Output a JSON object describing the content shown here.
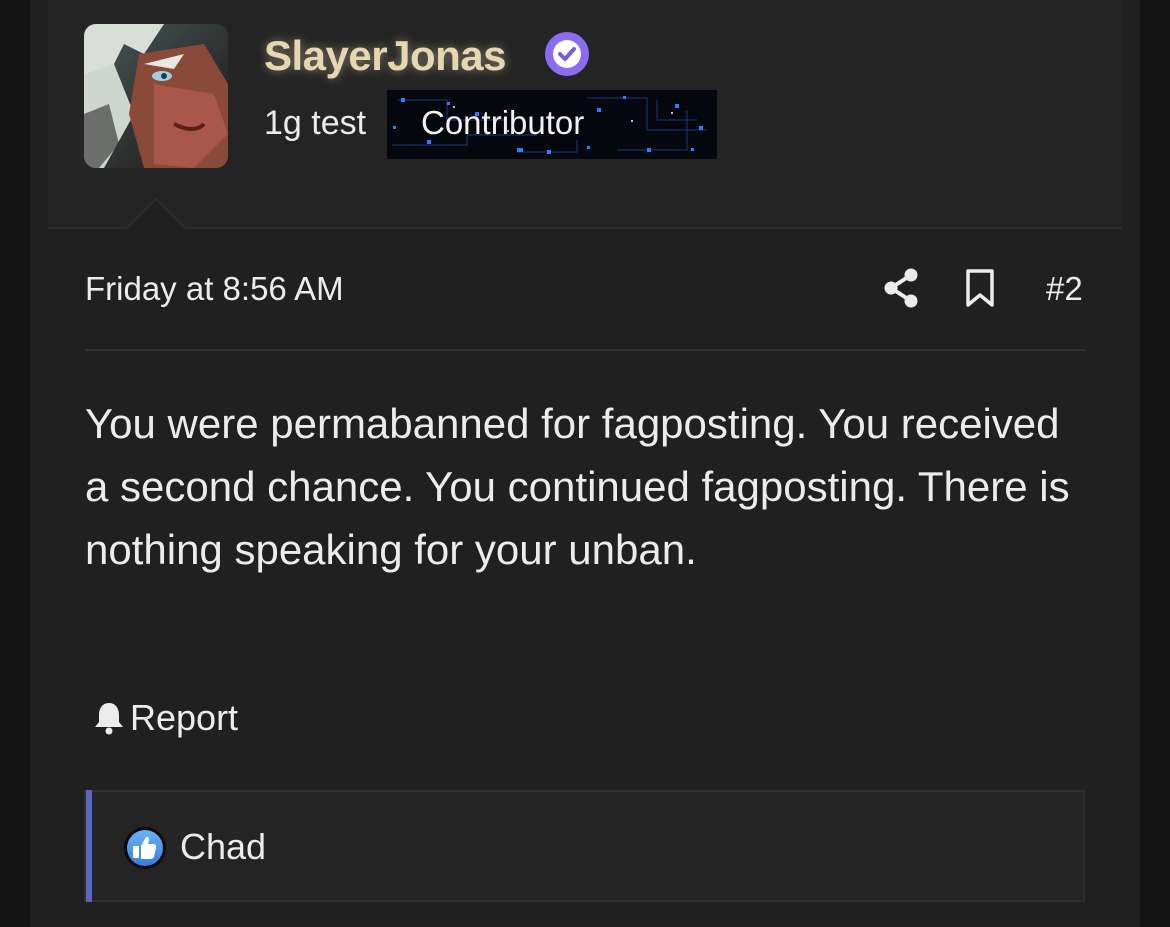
{
  "post": {
    "author": {
      "username": "SlayerJonas",
      "verified_icon": "verified-check-icon",
      "user_title": "1g test",
      "badge": "Contributor",
      "username_color": "#e6d7b0",
      "verified_color": "#8b6cf0"
    },
    "date": "Friday at 8:56 AM",
    "post_number": "#2",
    "actions": {
      "share_icon": "share-icon",
      "bookmark_icon": "bookmark-icon"
    },
    "message": "You were permabanned for fagposting. You received a second chance. You continued fagposting. There is nothing speaking for your unban.",
    "report": {
      "icon": "bell-icon",
      "label": "Report"
    },
    "reactions": {
      "icon": "like-icon",
      "users": "Chad",
      "accent_color": "#5865c3"
    }
  }
}
